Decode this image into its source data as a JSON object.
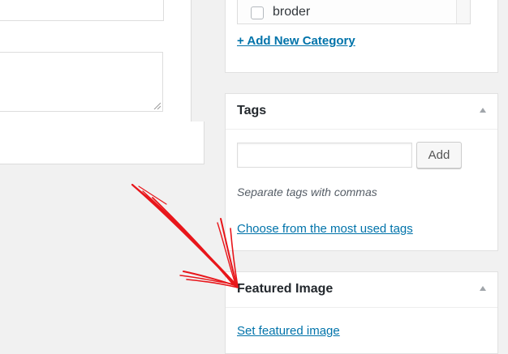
{
  "categories": {
    "item_label": "broder",
    "add_new_label": "+ Add New Category"
  },
  "tags": {
    "title": "Tags",
    "input_value": "",
    "add_button_label": "Add",
    "hint": "Separate tags with commas",
    "most_used_link": "Choose from the most used tags"
  },
  "featured_image": {
    "title": "Featured Image",
    "set_link": "Set featured image"
  },
  "annotation": {
    "color": "#e8161b",
    "icon": "hand-drawn-arrow"
  },
  "colors": {
    "link": "#0073aa",
    "background": "#f1f1f1"
  }
}
